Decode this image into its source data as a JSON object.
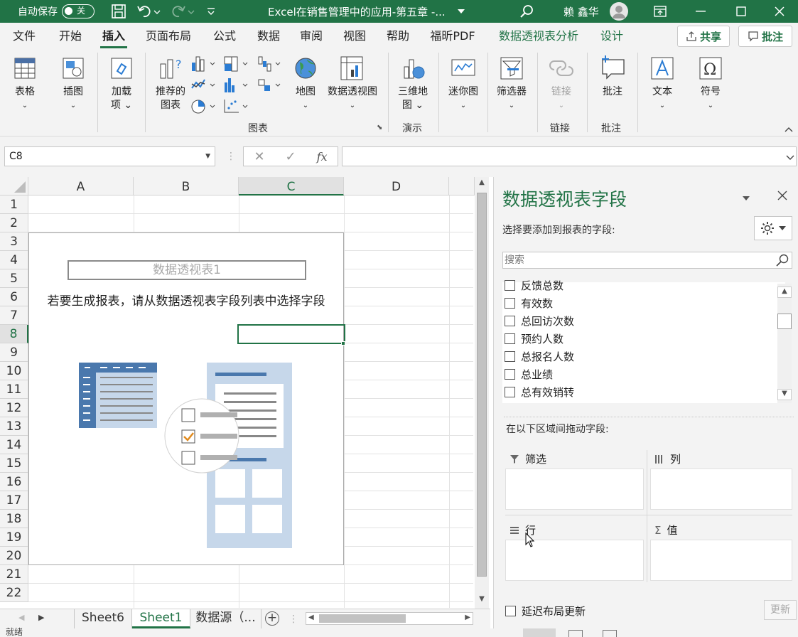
{
  "titlebar": {
    "autosave_label": "自动保存",
    "autosave_state": "关",
    "doc_title": "Excel在销售管理中的应用-第五章 -...",
    "user_name": "赖 鑫华"
  },
  "tabs": [
    "文件",
    "开始",
    "插入",
    "页面布局",
    "公式",
    "数据",
    "审阅",
    "视图",
    "帮助",
    "福昕PDF",
    "数据透视表分析",
    "设计"
  ],
  "share_label": "共享",
  "comment_label": "批注",
  "ribbon": {
    "table": "表格",
    "illustrations": "插图",
    "addins_1": "加载",
    "addins_2": "项",
    "rec_charts_1": "推荐的",
    "rec_charts_2": "图表",
    "maps": "地图",
    "pivotchart": "数据透视图",
    "map3d_1": "三维地",
    "map3d_2": "图",
    "sparklines": "迷你图",
    "slicer": "筛选器",
    "link": "链接",
    "comment": "批注",
    "text": "文本",
    "symbol": "符号",
    "group_charts": "图表",
    "group_tours": "演示",
    "group_links": "链接",
    "group_comments": "批注"
  },
  "namebox": "C8",
  "fx_label": "fx",
  "columns": [
    "A",
    "B",
    "C",
    "D"
  ],
  "rows": [
    "1",
    "2",
    "3",
    "4",
    "5",
    "6",
    "7",
    "8",
    "9",
    "10",
    "11",
    "12",
    "13",
    "14",
    "15",
    "16",
    "17",
    "18",
    "19",
    "20",
    "21",
    "22"
  ],
  "pivot": {
    "name": "数据透视表1",
    "hint": "若要生成报表，请从数据透视表字段列表中选择字段"
  },
  "sheets": [
    "Sheet6",
    "Sheet1",
    "数据源（..."
  ],
  "status_text": "就绪",
  "pane": {
    "title": "数据透视表字段",
    "subtitle": "选择要添加到报表的字段:",
    "search_placeholder": "搜索",
    "fields": [
      "反馈总数",
      "有效数",
      "总回访次数",
      "预约人数",
      "总报名人数",
      "总业绩",
      "总有效销转"
    ],
    "drag_label": "在以下区域间拖动字段:",
    "filter": "筛选",
    "columns": "列",
    "rows": "行",
    "values": "值",
    "defer": "延迟布局更新",
    "update": "更新"
  },
  "colors": {
    "accent": "#217346"
  }
}
